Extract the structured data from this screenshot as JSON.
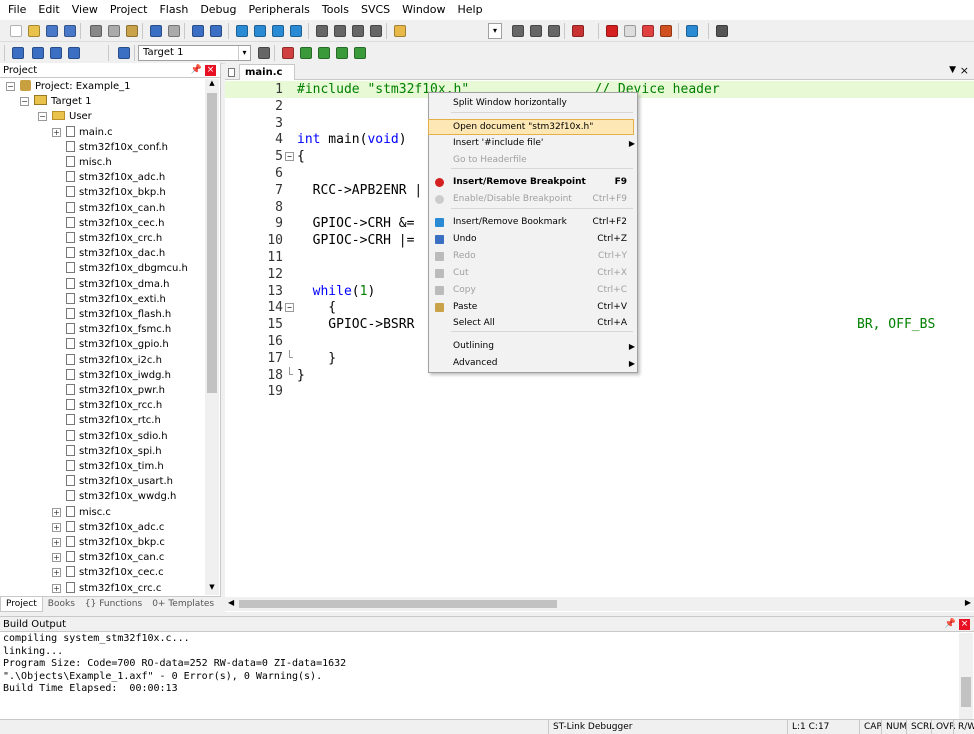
{
  "menu": [
    "File",
    "Edit",
    "View",
    "Project",
    "Flash",
    "Debug",
    "Peripherals",
    "Tools",
    "SVCS",
    "Window",
    "Help"
  ],
  "toolbar2": {
    "target_select": "Target 1"
  },
  "project_panel": {
    "title": "Project",
    "project": "Project: Example_1",
    "target": "Target 1",
    "group": "User",
    "headers": [
      "main.c",
      "stm32f10x_conf.h",
      "misc.h",
      "stm32f10x_adc.h",
      "stm32f10x_bkp.h",
      "stm32f10x_can.h",
      "stm32f10x_cec.h",
      "stm32f10x_crc.h",
      "stm32f10x_dac.h",
      "stm32f10x_dbgmcu.h",
      "stm32f10x_dma.h",
      "stm32f10x_exti.h",
      "stm32f10x_flash.h",
      "stm32f10x_fsmc.h",
      "stm32f10x_gpio.h",
      "stm32f10x_i2c.h",
      "stm32f10x_iwdg.h",
      "stm32f10x_pwr.h",
      "stm32f10x_rcc.h",
      "stm32f10x_rtc.h",
      "stm32f10x_sdio.h",
      "stm32f10x_spi.h",
      "stm32f10x_tim.h",
      "stm32f10x_usart.h",
      "stm32f10x_wwdg.h"
    ],
    "sources": [
      "misc.c",
      "stm32f10x_adc.c",
      "stm32f10x_bkp.c",
      "stm32f10x_can.c",
      "stm32f10x_cec.c",
      "stm32f10x_crc.c"
    ],
    "tabs": [
      "Project",
      "Books",
      "{} Functions",
      "0+ Templates"
    ]
  },
  "editor": {
    "tab": "main.c",
    "lines": [
      {
        "n": "1",
        "t": "#include \"stm32f10x.h\"                // Device header",
        "c": "pp"
      },
      {
        "n": "2",
        "t": "",
        "c": ""
      },
      {
        "n": "3",
        "t": "",
        "c": ""
      },
      {
        "n": "4",
        "t": "int main(void)",
        "c": "kw1"
      },
      {
        "n": "5",
        "t": "{",
        "c": ""
      },
      {
        "n": "6",
        "t": "",
        "c": ""
      },
      {
        "n": "7",
        "t": "  RCC->APB2ENR |",
        "c": ""
      },
      {
        "n": "8",
        "t": "",
        "c": ""
      },
      {
        "n": "9",
        "t": "  GPIOC->CRH &=",
        "c": ""
      },
      {
        "n": "10",
        "t": "  GPIOC->CRH |=",
        "c": ""
      },
      {
        "n": "11",
        "t": "",
        "c": ""
      },
      {
        "n": "12",
        "t": "",
        "c": ""
      },
      {
        "n": "13",
        "t": "  while(1)",
        "c": "kw2"
      },
      {
        "n": "14",
        "t": "    {",
        "c": ""
      },
      {
        "n": "15",
        "t": "    GPIOC->BSRR",
        "c": ""
      },
      {
        "n": "16",
        "t": "",
        "c": ""
      },
      {
        "n": "17",
        "t": "    }",
        "c": ""
      },
      {
        "n": "18",
        "t": "}",
        "c": ""
      },
      {
        "n": "19",
        "t": "",
        "c": ""
      }
    ],
    "line15_tail": "BR, OFF_BS"
  },
  "context_menu": [
    {
      "label": "Split Window horizontally",
      "shortcut": "",
      "state": "normal"
    },
    {
      "label": "Open document \"stm32f10x.h\"",
      "shortcut": "",
      "state": "highlight"
    },
    {
      "label": "Insert '#include file'",
      "shortcut": "",
      "state": "submenu"
    },
    {
      "label": "Go to Headerfile",
      "shortcut": "",
      "state": "disabled"
    },
    {
      "label": "Insert/Remove Breakpoint",
      "shortcut": "F9",
      "state": "bold"
    },
    {
      "label": "Enable/Disable Breakpoint",
      "shortcut": "Ctrl+F9",
      "state": "disabled"
    },
    {
      "label": "Insert/Remove Bookmark",
      "shortcut": "Ctrl+F2",
      "state": "normal"
    },
    {
      "label": "Undo",
      "shortcut": "Ctrl+Z",
      "state": "normal"
    },
    {
      "label": "Redo",
      "shortcut": "Ctrl+Y",
      "state": "disabled"
    },
    {
      "label": "Cut",
      "shortcut": "Ctrl+X",
      "state": "disabled"
    },
    {
      "label": "Copy",
      "shortcut": "Ctrl+C",
      "state": "disabled"
    },
    {
      "label": "Paste",
      "shortcut": "Ctrl+V",
      "state": "normal"
    },
    {
      "label": "Select All",
      "shortcut": "Ctrl+A",
      "state": "normal"
    },
    {
      "label": "Outlining",
      "shortcut": "",
      "state": "submenu"
    },
    {
      "label": "Advanced",
      "shortcut": "",
      "state": "submenu"
    }
  ],
  "build_output": {
    "title": "Build Output",
    "lines": [
      "compiling system_stm32f10x.c...",
      "linking...",
      "Program Size: Code=700 RO-data=252 RW-data=0 ZI-data=1632",
      "\".\\Objects\\Example_1.axf\" - 0 Error(s), 0 Warning(s).",
      "Build Time Elapsed:  00:00:13"
    ]
  },
  "status": {
    "debugger": "ST-Link Debugger",
    "position": "L:1 C:17",
    "caps": "CAP",
    "num": "NUM",
    "scrl": "SCRL",
    "ovr": "OVR",
    "rw": "R/W"
  },
  "colors": {
    "line1_bg": "#e8f9d6",
    "highlight": "#fde8b5",
    "highlight_border": "#e5b04c",
    "keyword": "#0000ff",
    "preproc": "#008000"
  }
}
